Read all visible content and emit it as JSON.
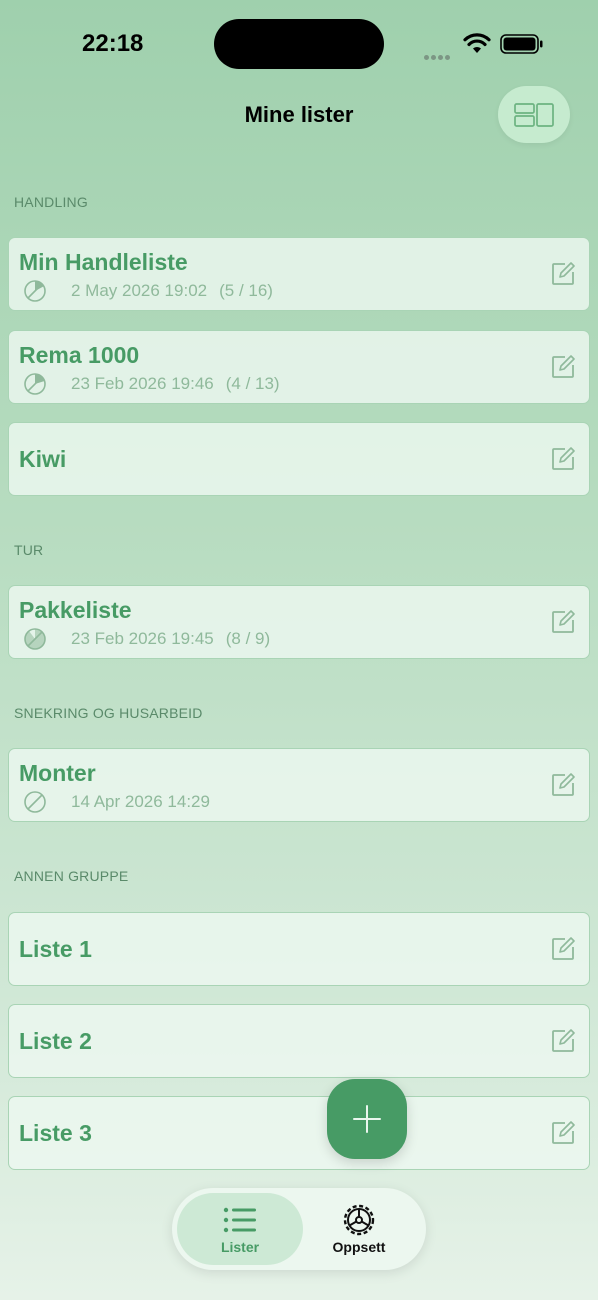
{
  "status_bar": {
    "time": "22:18"
  },
  "nav": {
    "title": "Mine lister",
    "layout_icon": "layout-toggle-icon"
  },
  "sections": [
    {
      "header": "HANDLING",
      "lists": [
        {
          "title": "Min Handleliste",
          "date": "2 May 2026 19:02",
          "progress": "(5 / 16)"
        },
        {
          "title": "Rema 1000",
          "date": "23 Feb 2026 19:46",
          "progress": "(4 / 13)"
        },
        {
          "title": "Kiwi"
        }
      ]
    },
    {
      "header": "TUR",
      "lists": [
        {
          "title": "Pakkeliste",
          "date": "23 Feb 2026 19:45",
          "progress": "(8 / 9)"
        }
      ]
    },
    {
      "header": "SNEKRING OG HUSARBEID",
      "lists": [
        {
          "title": "Monter",
          "date": "14 Apr 2026 14:29"
        }
      ]
    },
    {
      "header": "ANNEN GRUPPE",
      "lists": [
        {
          "title": "Liste 1"
        },
        {
          "title": "Liste 2"
        },
        {
          "title": "Liste 3"
        }
      ]
    }
  ],
  "fab": {
    "icon": "plus-icon"
  },
  "tab_bar": {
    "tabs": [
      {
        "label": "Lister",
        "icon": "list-icon",
        "active": true
      },
      {
        "label": "Oppsett",
        "icon": "gear-icon",
        "active": false
      }
    ]
  },
  "colors": {
    "accent": "#479b65",
    "card_bg": "#edf8f0",
    "card_border": "#a9d4b5"
  }
}
